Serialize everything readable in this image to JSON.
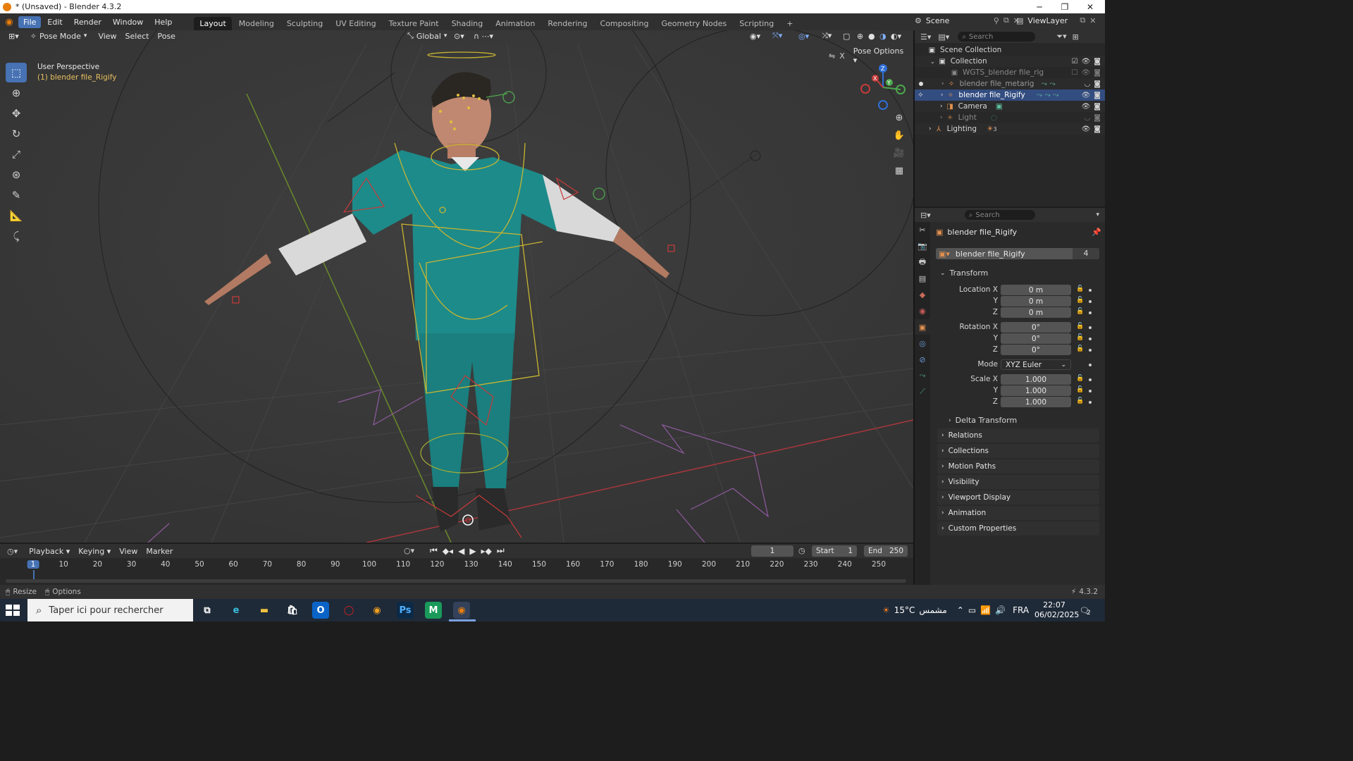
{
  "window": {
    "title": "* (Unsaved) - Blender 4.3.2"
  },
  "menus": [
    "File",
    "Edit",
    "Render",
    "Window",
    "Help"
  ],
  "workspaces": [
    "Layout",
    "Modeling",
    "Sculpting",
    "UV Editing",
    "Texture Paint",
    "Shading",
    "Animation",
    "Rendering",
    "Compositing",
    "Geometry Nodes",
    "Scripting"
  ],
  "top_right": {
    "scene": "Scene",
    "view_layer": "ViewLayer"
  },
  "viewport": {
    "mode": "Pose Mode",
    "menu": [
      "View",
      "Select",
      "Pose"
    ],
    "orientation": "Global",
    "pose_options": "Pose Options",
    "overlay_title": "User Perspective",
    "overlay_object": "(1) blender file_Rigify",
    "gizmo_axes": {
      "x": "X",
      "y": "Y",
      "z": "Z"
    }
  },
  "outliner": {
    "search_placeholder": "Search",
    "rows": [
      {
        "label": "Scene Collection"
      },
      {
        "label": "Collection"
      },
      {
        "label": "WGTS_blender file_rig"
      },
      {
        "label": "blender file_metarig"
      },
      {
        "label": "blender file_Rigify"
      },
      {
        "label": "Camera"
      },
      {
        "label": "Light"
      },
      {
        "label": "Lighting",
        "badge": "3"
      }
    ]
  },
  "properties": {
    "search_placeholder": "Search",
    "object_title": "blender file_Rigify",
    "datablock_name": "blender file_Rigify",
    "users_count": "4",
    "transform_label": "Transform",
    "location": {
      "label": "Location X",
      "x": "0 m",
      "y": "0 m",
      "z": "0 m"
    },
    "rotation": {
      "label": "Rotation X",
      "x": "0°",
      "y": "0°",
      "z": "0°"
    },
    "mode_label": "Mode",
    "mode_value": "XYZ Euler",
    "scale": {
      "label": "Scale X",
      "x": "1.000",
      "y": "1.000",
      "z": "1.000"
    },
    "axis_y": "Y",
    "axis_z": "Z",
    "panels": [
      "Delta Transform",
      "Relations",
      "Collections",
      "Motion Paths",
      "Visibility",
      "Viewport Display",
      "Animation",
      "Custom Properties"
    ]
  },
  "timeline": {
    "menus": [
      "Playback",
      "Keying",
      "View",
      "Marker"
    ],
    "current_frame": "1",
    "start_label": "Start",
    "start": "1",
    "end_label": "End",
    "end": "250",
    "ruler": [
      "1",
      "10",
      "20",
      "30",
      "40",
      "50",
      "60",
      "70",
      "80",
      "90",
      "100",
      "110",
      "120",
      "130",
      "140",
      "150",
      "160",
      "170",
      "180",
      "190",
      "200",
      "210",
      "220",
      "230",
      "240",
      "250"
    ]
  },
  "statusbar": {
    "resize": "Resize",
    "options": "Options",
    "version": "4.3.2"
  },
  "taskbar": {
    "search_placeholder": "Taper ici pour rechercher",
    "weather": "15°C",
    "weather_text": "مشمس",
    "language": "FRA",
    "time": "22:07",
    "date": "06/02/2025",
    "notification_count": "2"
  },
  "colors": {
    "accent": "#4772b3",
    "selection": "#334d80",
    "panel_bg": "#2a2a2a",
    "viewport_bg": "#393939"
  }
}
